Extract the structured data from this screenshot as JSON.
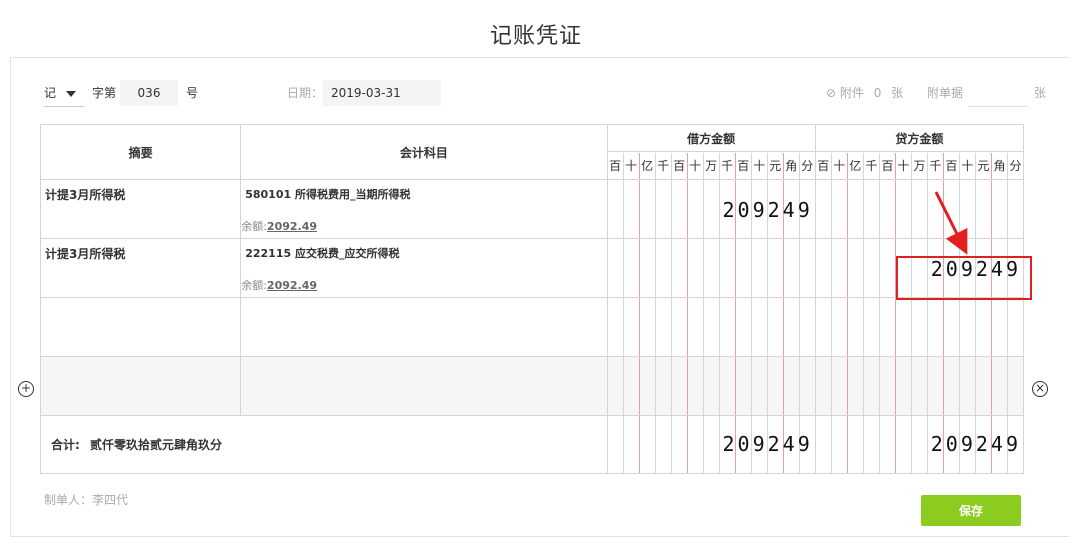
{
  "page": {
    "title": "记账凭证"
  },
  "header": {
    "voucher_type": "记",
    "zi_label": "字第",
    "number": "036",
    "hao_label": "号",
    "date_label": "日期：",
    "date_value": "2019-03-31",
    "attachment_label": "附件",
    "attachment_count": "0",
    "attachment_unit": "张",
    "docs_label": "附单据",
    "docs_value": "",
    "docs_unit": "张"
  },
  "table": {
    "col_summary": "摘要",
    "col_account": "会计科目",
    "col_debit": "借方金额",
    "col_credit": "贷方金额",
    "digit_units": [
      "百",
      "十",
      "亿",
      "千",
      "百",
      "十",
      "万",
      "千",
      "百",
      "十",
      "元",
      "角",
      "分"
    ],
    "rows": [
      {
        "summary": "计提3月所得税",
        "account": "580101 所得税费用_当期所得税",
        "balance_label": "余额:",
        "balance": "2092.49",
        "debit": "209249",
        "credit": ""
      },
      {
        "summary": "计提3月所得税",
        "account": "222115 应交税费_应交所得税",
        "balance_label": "余额:",
        "balance": "2092.49",
        "debit": "",
        "credit": "209249"
      }
    ],
    "total_label": "合计:",
    "total_words": "贰仟零玖拾贰元肆角玖分",
    "total_debit": "209249",
    "total_credit": "209249"
  },
  "footer": {
    "maker_label": "制单人：李四代",
    "save_label": "保存"
  },
  "colors": {
    "accent": "#8ccc1e",
    "highlight": "#e02020"
  }
}
